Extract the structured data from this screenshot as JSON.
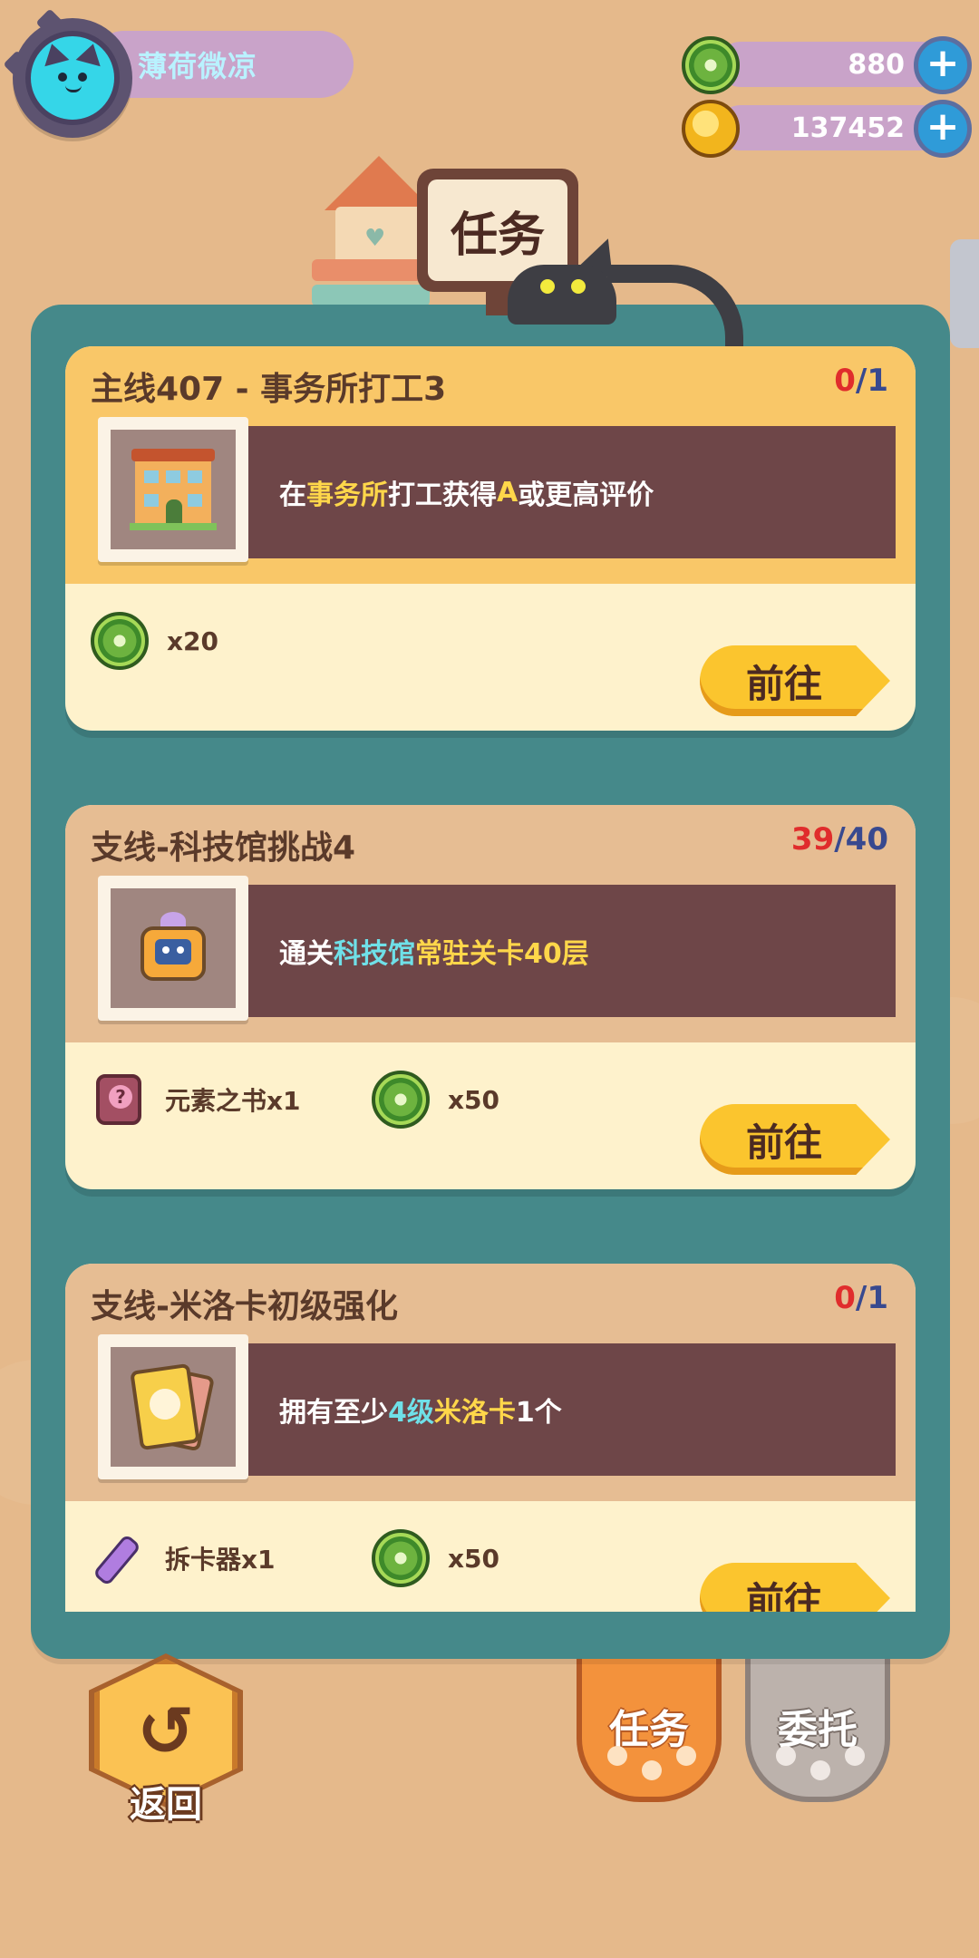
{
  "player": {
    "name": "薄荷微凉",
    "avatar_icon": "cat-face-icon"
  },
  "currencies": [
    {
      "icon": "donut-currency-icon",
      "value": "880",
      "add_icon": "plus-icon"
    },
    {
      "icon": "gold-coin-icon",
      "value": "137452",
      "add_icon": "plus-icon"
    }
  ],
  "header": {
    "title": "任务"
  },
  "tasks": [
    {
      "title": "主线407 - 事务所打工3",
      "progress_current": "0",
      "progress_sep": "/",
      "progress_total": "1",
      "thumb_icon": "office-building-icon",
      "desc_parts": [
        "在",
        "事务所",
        "打工获得",
        "A",
        "或更高评价"
      ],
      "rewards": [
        {
          "icon": "donut-currency-icon",
          "text": "x20"
        }
      ],
      "go_label": "前往"
    },
    {
      "title": "支线-科技馆挑战4",
      "progress_current": "39",
      "progress_sep": "/",
      "progress_total": "40",
      "thumb_icon": "robot-icon",
      "desc_parts": [
        "通关",
        "科技馆",
        "常驻关卡",
        "40层"
      ],
      "rewards": [
        {
          "icon": "element-book-icon",
          "text": "元素之书x1"
        },
        {
          "icon": "donut-currency-icon",
          "text": "x50"
        }
      ],
      "go_label": "前往"
    },
    {
      "title": "支线-米洛卡初级强化",
      "progress_current": "0",
      "progress_sep": "/",
      "progress_total": "1",
      "thumb_icon": "card-pack-icon",
      "desc_parts": [
        "拥有至少",
        "4级",
        "米洛卡",
        "1个"
      ],
      "rewards": [
        {
          "icon": "card-remover-icon",
          "text": "拆卡器x1"
        },
        {
          "icon": "donut-currency-icon",
          "text": "x50"
        }
      ],
      "go_label": "前往"
    }
  ],
  "bottom": {
    "back_label": "返回",
    "back_icon": "return-arrow-icon",
    "tab_tasks": "任务",
    "tab_delegate": "委托"
  },
  "colors": {
    "background": "#e5b98b",
    "panel": "#45898a",
    "main_task_header": "#f9c768",
    "side_task_header": "#e6bd93",
    "desc_box": "#6e4648",
    "highlight_yellow": "#ffd74a",
    "highlight_cyan": "#6fe0e8",
    "progress_red": "#e02c2c",
    "progress_blue": "#38498f",
    "go_button": "#fbc52e"
  }
}
